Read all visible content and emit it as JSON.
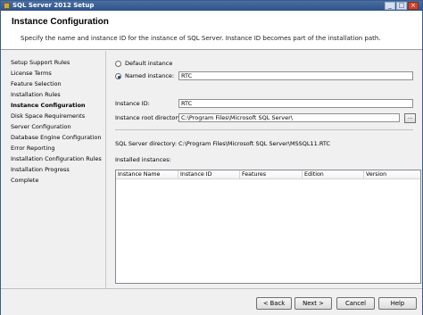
{
  "window": {
    "title": "SQL Server 2012 Setup",
    "controls": [
      "_",
      "□",
      "×"
    ]
  },
  "header": {
    "title": "Instance Configuration",
    "description": "Specify the name and instance ID for the instance of SQL Server. Instance ID becomes part of the installation path."
  },
  "sidebar": {
    "items": [
      "Setup Support Rules",
      "License Terms",
      "Feature Selection",
      "Installation Rules",
      "Instance Configuration",
      "Disk Space Requirements",
      "Server Configuration",
      "Database Engine Configuration",
      "Error Reporting",
      "Installation Configuration Rules",
      "Installation Progress",
      "Complete"
    ],
    "active_index": 4
  },
  "form": {
    "default_instance_label": "Default instance",
    "named_instance_label": "Named instance:",
    "named_instance_value": "RTC",
    "instance_id_label": "Instance ID:",
    "instance_id_value": "RTC",
    "root_dir_label": "Instance root directory:",
    "root_dir_value": "C:\\Program Files\\Microsoft SQL Server\\",
    "browse_label": "...",
    "sql_dir_label": "SQL Server directory:",
    "sql_dir_value": "C:\\Program Files\\Microsoft SQL Server\\MSSQL11.RTC",
    "installed_label": "Installed instances:"
  },
  "table": {
    "columns": [
      "Instance Name",
      "Instance ID",
      "Features",
      "Edition",
      "Version"
    ],
    "rows": []
  },
  "footer": {
    "back": "< Back",
    "next": "Next >",
    "cancel": "Cancel",
    "help": "Help"
  },
  "colors": {
    "titlebar": "#2e5288",
    "header_bg": "#ffffff",
    "window_bg": "#f0f0f0"
  },
  "icons": {
    "app": "sql-server-setup-icon"
  }
}
